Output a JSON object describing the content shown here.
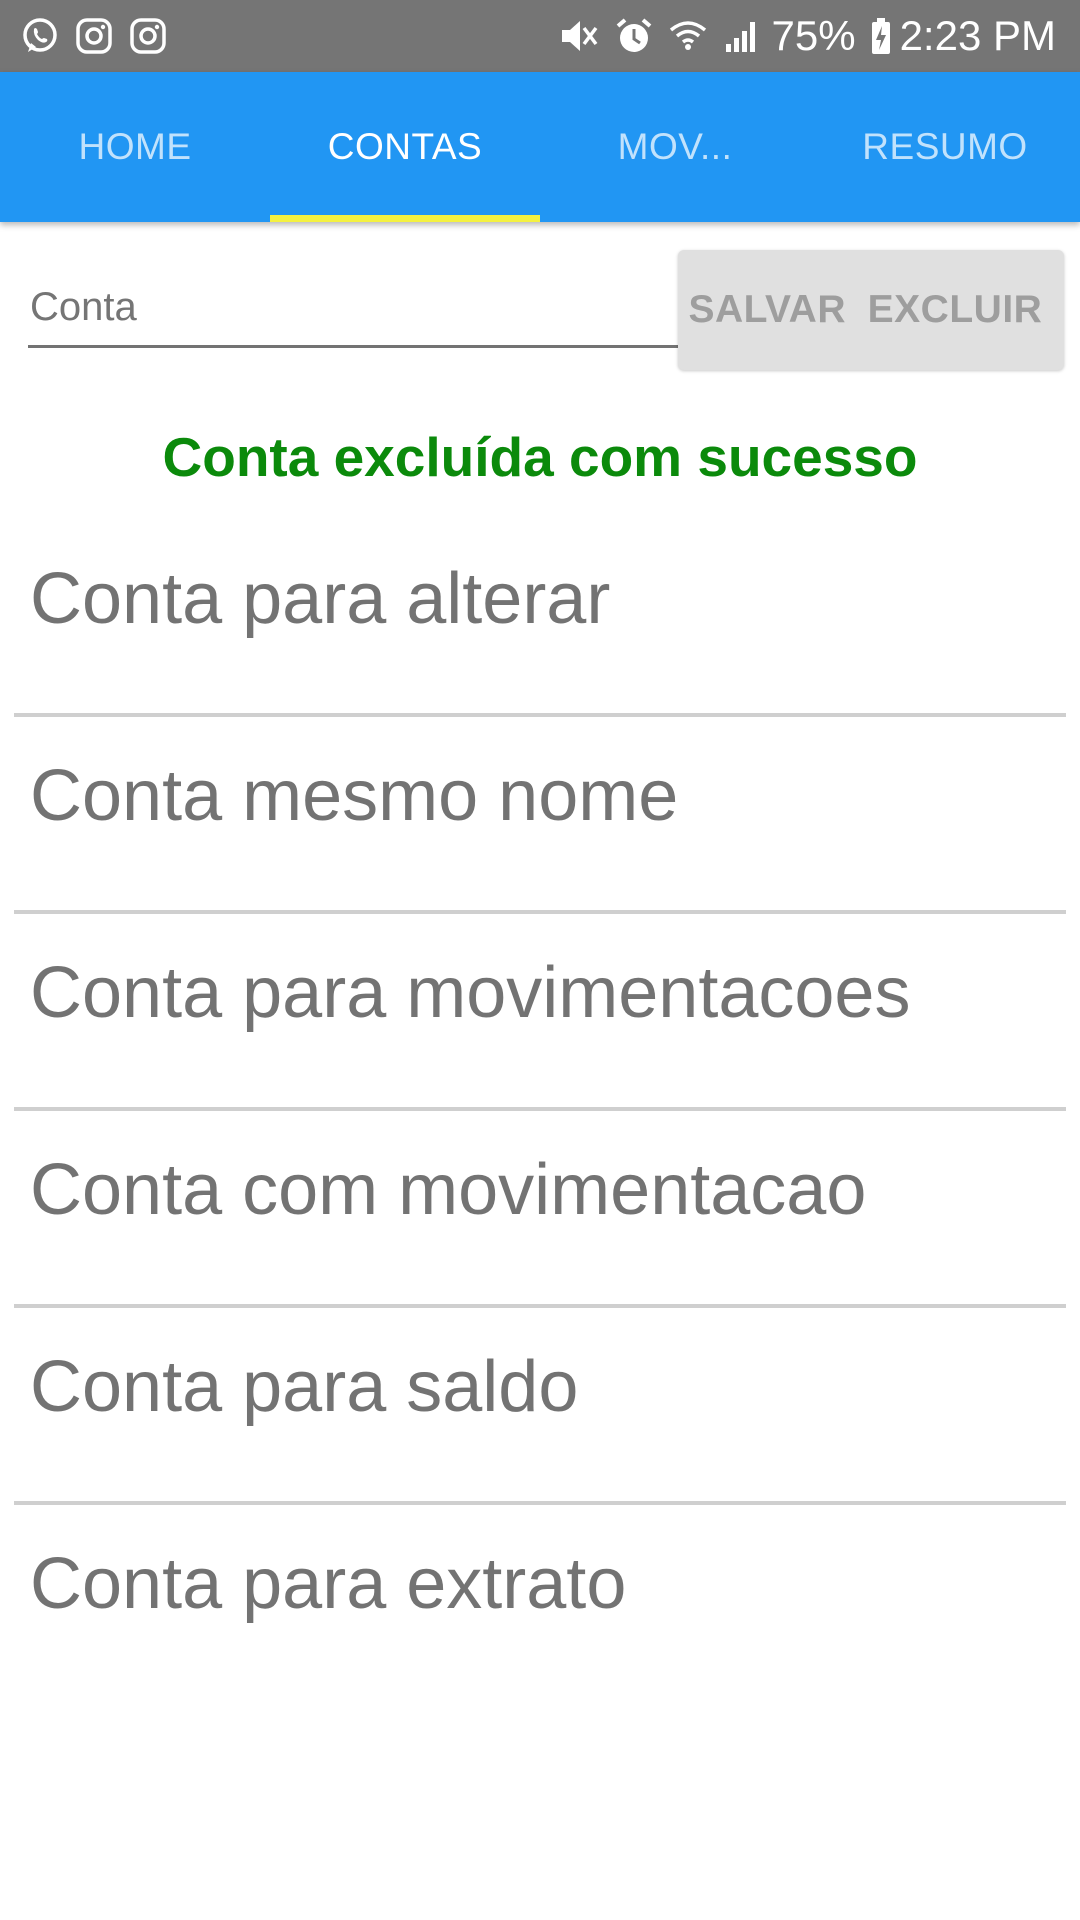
{
  "status_bar": {
    "left_icons": [
      "whatsapp-icon",
      "instagram-icon",
      "instagram-icon"
    ],
    "right_icons": [
      "mute-icon",
      "alarm-icon",
      "wifi-icon",
      "signal-icon"
    ],
    "battery": "75%",
    "time": "2:23 PM"
  },
  "tabs": [
    {
      "label": "HOME",
      "active": false
    },
    {
      "label": "CONTAS",
      "active": true
    },
    {
      "label": "MOV...",
      "active": false
    },
    {
      "label": "RESUMO",
      "active": false
    }
  ],
  "form": {
    "conta_placeholder": "Conta",
    "conta_value": "",
    "save_label": "SALVAR",
    "delete_label": "EXCLUIR"
  },
  "message": "Conta excluída com sucesso",
  "accounts": [
    "Conta para alterar",
    "Conta mesmo nome",
    "Conta para movimentacoes",
    "Conta com movimentacao",
    "Conta para saldo",
    "Conta para extrato"
  ],
  "colors": {
    "app_bar": "#2196F3",
    "tab_indicator": "#F4F141",
    "status_bar": "#757575",
    "success_text": "#0B8A0B"
  }
}
